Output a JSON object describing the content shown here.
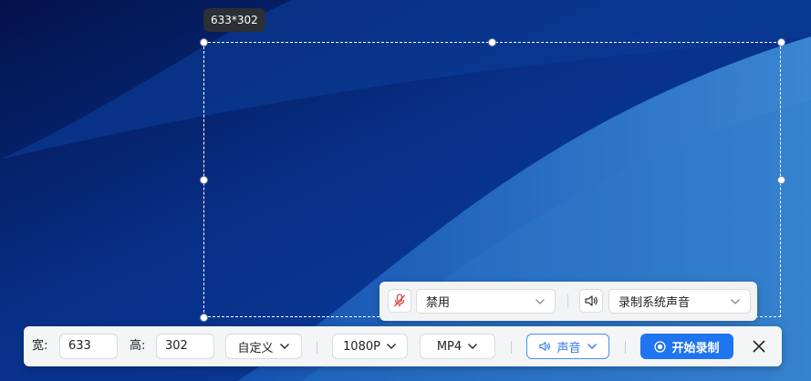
{
  "selection": {
    "size_label": "633*302"
  },
  "audio_panel": {
    "mic_option": "禁用",
    "speaker_option": "录制系统声音"
  },
  "toolbar": {
    "width_label": "宽:",
    "width_value": "633",
    "height_label": "高:",
    "height_value": "302",
    "aspect_label": "自定义",
    "quality_label": "1080P",
    "format_label": "MP4",
    "sound_label": "声音",
    "start_label": "开始录制"
  },
  "colors": {
    "accent": "#1f74f0",
    "desktop_dark": "#041a55",
    "desktop_light": "#2a6fc2"
  },
  "icons": [
    "mic-muted-icon",
    "speaker-icon",
    "chevron-down-icon",
    "record-icon",
    "close-icon"
  ]
}
